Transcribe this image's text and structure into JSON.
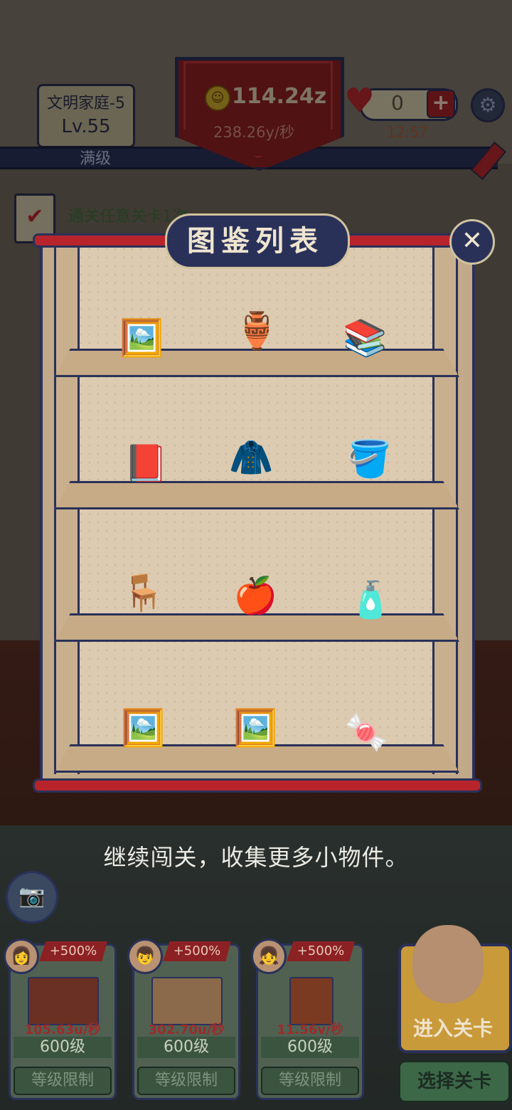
{
  "top": {
    "family_name": "文明家庭-5",
    "level": "Lv.55",
    "max_level": "满级",
    "coins": "114.24z",
    "coin_rate": "238.26y/秒",
    "hearts": "0",
    "timer": "12:57",
    "coin_icon": "smiley-coin-icon",
    "heart_icon": "heart-icon",
    "plus_icon": "plus-icon",
    "settings_icon": "gear-icon"
  },
  "task": {
    "text": "通关任意关卡1次"
  },
  "modal": {
    "title": "图鉴列表",
    "close_symbol": "✕",
    "shelf_rows": [
      [
        "🖼️",
        "🏺",
        "📚"
      ],
      [
        "📕",
        "🧥",
        "🪣"
      ],
      [
        "🪑",
        "🍎",
        "🧴"
      ],
      [
        "🖼️",
        "🖼️",
        "🍬"
      ]
    ]
  },
  "hint": "继续闯关，收集更多小物件。",
  "cards": [
    {
      "boost": "+500%",
      "rate": "105.63u/秒",
      "level": "600级",
      "limit": "等级限制"
    },
    {
      "boost": "+500%",
      "rate": "302.70u/秒",
      "level": "600级",
      "limit": "等级限制"
    },
    {
      "boost": "+500%",
      "rate": "11.56v/秒",
      "level": "600级",
      "limit": "等级限制"
    }
  ],
  "buttons": {
    "enter_level": "进入关卡",
    "select_level": "选择关卡",
    "camera_icon": "camera-icon"
  },
  "colors": {
    "navy": "#2a3159",
    "red": "#b8242b",
    "shelf": "#dccbb1"
  }
}
